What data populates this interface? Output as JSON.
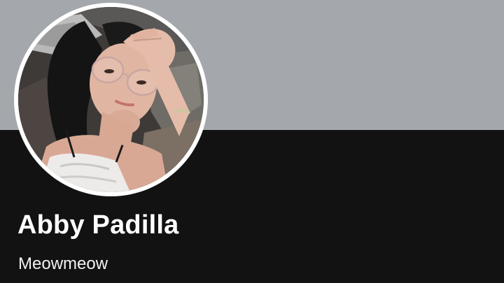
{
  "profile": {
    "name": "Abby Padilla",
    "bio": "Meowmeow",
    "avatar_icon": "profile-photo",
    "cover_color": "#a4a7ac",
    "background_color": "#121212"
  }
}
